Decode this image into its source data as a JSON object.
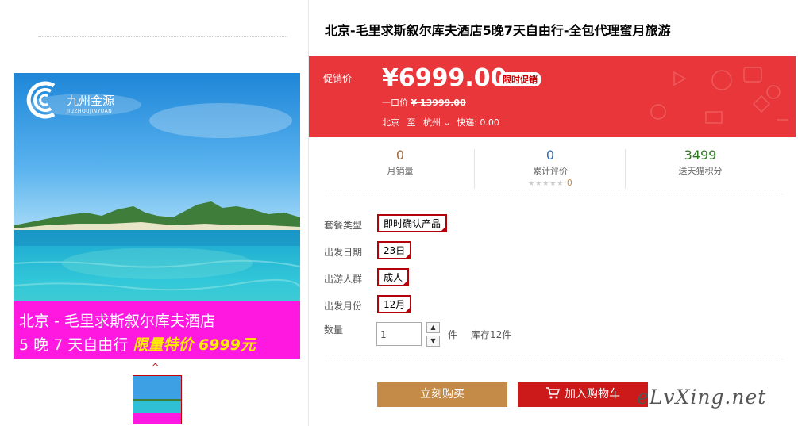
{
  "product": {
    "title": "北京-毛里求斯叙尔库夫酒店5晚7天自由行-全包代理蜜月旅游"
  },
  "image": {
    "logo_name": "九州金源",
    "logo_sub": "JIUZHOUJINYUAN",
    "banner_line1": "北京 - 毛里求斯叙尔库夫酒店",
    "banner_line2_prefix": "5 晚 7 天自由行",
    "banner_line2_promo": "限量特价 6999元",
    "thumb_arrow": "^"
  },
  "price": {
    "label": "促销价",
    "value": "¥6999.00",
    "badge": "限时促销",
    "original_label": "一口价",
    "original_value": "¥ 13999.00",
    "from": "北京",
    "to_word": "至",
    "dest": "杭州",
    "dest_chevron": "⌄",
    "shipping": "快递: 0.00"
  },
  "stats": [
    {
      "value": "0",
      "label": "月销量",
      "color": "#a06a3c"
    },
    {
      "value": "0",
      "label": "累计评价",
      "color": "#2f6fb8",
      "stars": "★★★★★",
      "review_count": "0"
    },
    {
      "value": "3499",
      "label": "送天猫积分",
      "color": "#2c7a1e"
    }
  ],
  "options": [
    {
      "label": "套餐类型",
      "value": "即时确认产品"
    },
    {
      "label": "出发日期",
      "value": "23日"
    },
    {
      "label": "出游人群",
      "value": "成人"
    },
    {
      "label": "出发月份",
      "value": "12月"
    }
  ],
  "quantity": {
    "label": "数量",
    "value": "1",
    "unit": "件",
    "stock": "库存12件",
    "up": "▲",
    "down": "▼"
  },
  "buttons": {
    "buy": "立刻购买",
    "cart": "加入购物车"
  },
  "watermark": "eLvXing.net",
  "colors": {
    "accent_red": "#e8363a",
    "buy_button": "#c48a48",
    "cart_button": "#cc1a1a",
    "banner_magenta": "#ff19e0"
  }
}
